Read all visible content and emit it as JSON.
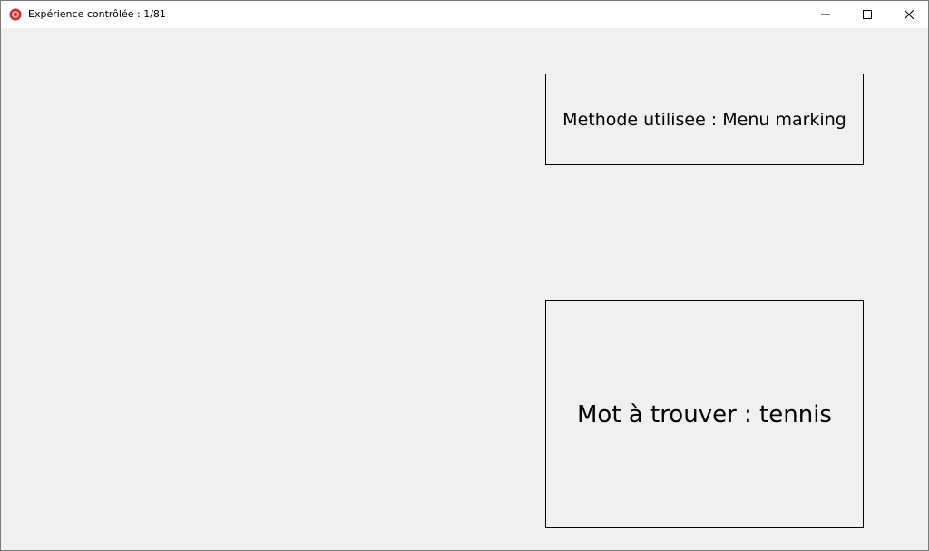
{
  "window": {
    "title": "Expérience contrôlée : 1/81",
    "app_icon": "red-circle-app-icon",
    "controls": {
      "minimize_icon": "minimize-icon",
      "maximize_icon": "maximize-icon",
      "close_icon": "close-icon"
    }
  },
  "main": {
    "method_label": "Methode utilisee : Menu marking",
    "word_label": "Mot à trouver : tennis"
  },
  "colors": {
    "background": "#f0f0f0",
    "titlebar": "#ffffff",
    "border": "#000000",
    "app_icon_red": "#d9262b"
  }
}
